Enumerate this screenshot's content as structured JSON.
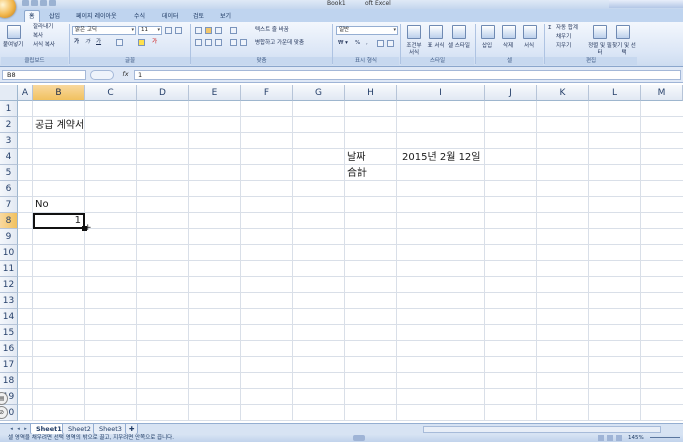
{
  "titlebar": {
    "workbook": "Book1",
    "app_suffix": "oft Excel"
  },
  "ribbon_tabs": [
    "홈",
    "삽입",
    "페이지 레이아웃",
    "수식",
    "데이터",
    "검토",
    "보기"
  ],
  "clipboard": {
    "paste": "붙여넣기",
    "cut": "잘라내기",
    "copy": "복사",
    "format_painter": "서식 복사",
    "group": "클립보드"
  },
  "font": {
    "name": "맑은 고딕",
    "size": "11",
    "group": "글꼴"
  },
  "alignment": {
    "wrap_text": "텍스트 줄 바꿈",
    "merge_center": "병합하고 가운데 맞춤",
    "group": "맞춤"
  },
  "number": {
    "format": "일반",
    "group": "표시 형식"
  },
  "styles": {
    "conditional": "조건부 서식",
    "table": "표 서식",
    "cell_styles": "셀 스타일",
    "group": "스타일"
  },
  "cells": {
    "insert": "삽입",
    "delete": "삭제",
    "format": "서식",
    "group": "셀"
  },
  "editing": {
    "autosum": "자동 합계",
    "fill": "채우기",
    "clear": "지우기",
    "sort_filter": "정렬 및 필터",
    "find_select": "찾기 및 선택",
    "group": "편집"
  },
  "formula_bar": {
    "name_box": "B8",
    "fx": "fx",
    "value": "1"
  },
  "columns": [
    "A",
    "B",
    "C",
    "D",
    "E",
    "F",
    "G",
    "H",
    "I",
    "J",
    "K",
    "L",
    "M"
  ],
  "rows": [
    "1",
    "2",
    "3",
    "4",
    "5",
    "6",
    "7",
    "8",
    "9",
    "10",
    "11",
    "12",
    "13",
    "14",
    "15",
    "16",
    "17",
    "18",
    "19",
    "20"
  ],
  "cells_data": {
    "b2": "공급 계약서",
    "h4": "날짜",
    "i4": "2015년 2월 12일",
    "h5": "合計",
    "b7": "No",
    "b8": "1"
  },
  "sheets": [
    "Sheet1",
    "Sheet2",
    "Sheet3"
  ],
  "status": {
    "message": "셀 영역을 채우려면 선택 영역의 밖으로 끌고, 지우려면 안쪽으로 끕니다.",
    "zoom": "145%"
  }
}
